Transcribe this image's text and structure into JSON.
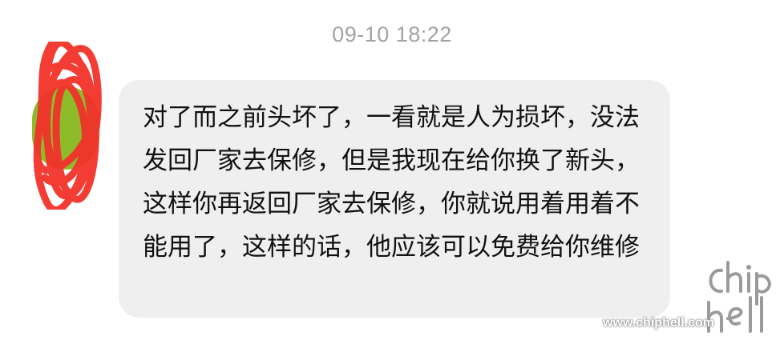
{
  "chat": {
    "timestamp": "09-10 18:22",
    "message": {
      "sender_avatar": "avatar-redacted",
      "text": "对了而之前头坏了，一看就是人为损坏，没法发回厂家去保修，但是我现在给你换了新头，这样你再返回厂家去保修，你就说用着用着不能用了，这样的话，他应该可以免费给你维修"
    }
  },
  "watermark": {
    "logo_text": "chiphell",
    "url": "www.chiphell.com"
  },
  "colors": {
    "background": "#ffffff",
    "bubble": "#efefef",
    "timestamp": "#a3a3a3",
    "message_text": "#111111",
    "redaction": "#f2322a",
    "avatar": "#8dbb2a"
  }
}
